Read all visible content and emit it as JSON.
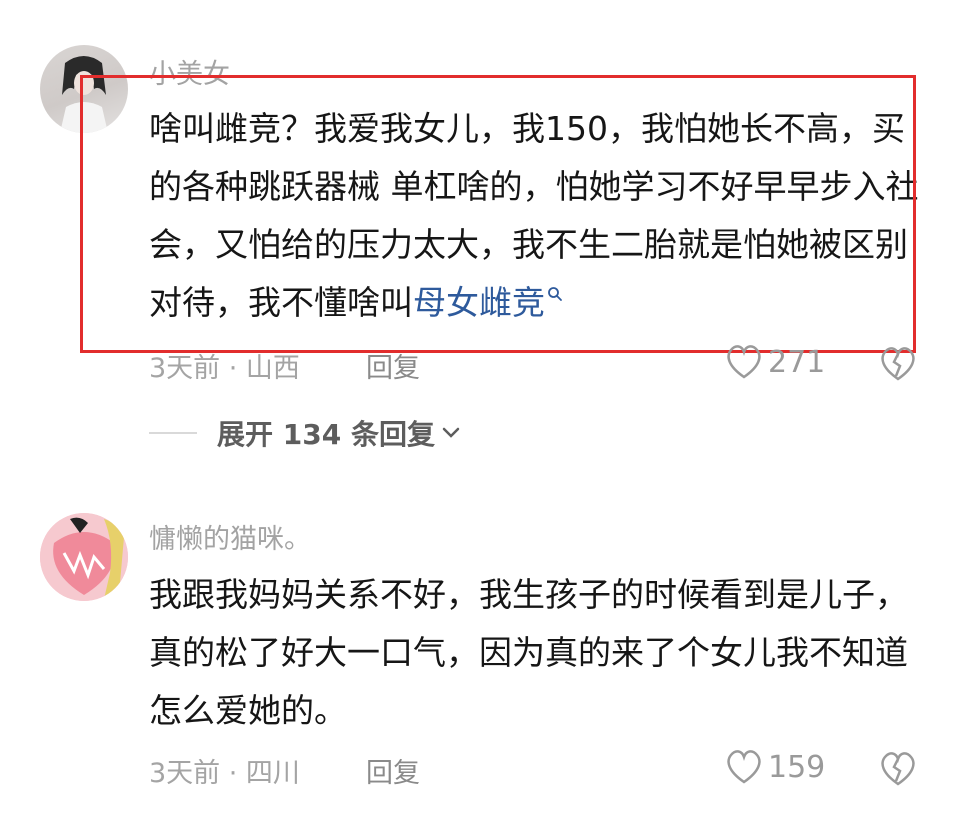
{
  "comments": [
    {
      "username": "小美女",
      "text_main": "啥叫雌竞？我爱我女儿，我150，我怕她长不高，买的各种跳跃器械 单杠啥的，怕她学习不好早早步入社会，又怕给的压力太大，我不生二胎就是怕她被区别对待，我不懂啥叫",
      "link_text": "母女雌竞",
      "meta": "3天前 · 山西",
      "reply_label": "回复",
      "likes": "271",
      "expand_label": "展开 134 条回复"
    },
    {
      "username": "慵懒的猫咪。",
      "text": "我跟我妈妈关系不好，我生孩子的时候看到是儿子，真的松了好大一口气，因为真的来了个女儿我不知道怎么爱她的。",
      "meta": "3天前 · 四川",
      "reply_label": "回复",
      "likes": "159"
    }
  ],
  "colors": {
    "highlight_border": "#e22d2d",
    "link": "#2e5a9c",
    "meta": "#a4a4a4"
  },
  "icons": [
    "avatar-girl",
    "avatar-cat",
    "search-icon",
    "heart-icon",
    "broken-heart-icon",
    "chevron-down-icon"
  ]
}
